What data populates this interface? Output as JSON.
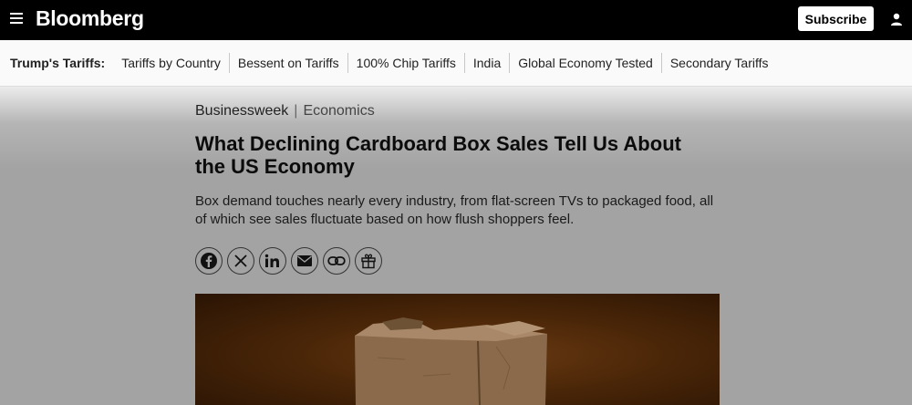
{
  "header": {
    "logo": "Bloomberg",
    "subscribe_label": "Subscribe"
  },
  "nav": {
    "label": "Trump's Tariffs:",
    "items": [
      {
        "label": "Tariffs by Country"
      },
      {
        "label": "Bessent on Tariffs"
      },
      {
        "label": "100% Chip Tariffs"
      },
      {
        "label": "India"
      },
      {
        "label": "Global Economy Tested"
      },
      {
        "label": "Secondary Tariffs"
      }
    ]
  },
  "article": {
    "kicker_brand": "Businessweek",
    "kicker_separator": "|",
    "kicker_section": "Economics",
    "headline": "What Declining Cardboard Box Sales Tell Us About the US Economy",
    "dek": "Box demand touches nearly every industry, from flat-screen TVs to packaged food, all of which see sales fluctuate based on how flush shoppers feel.",
    "share_icons": [
      "facebook-icon",
      "x-icon",
      "linkedin-icon",
      "email-icon",
      "link-icon",
      "gift-icon"
    ]
  }
}
